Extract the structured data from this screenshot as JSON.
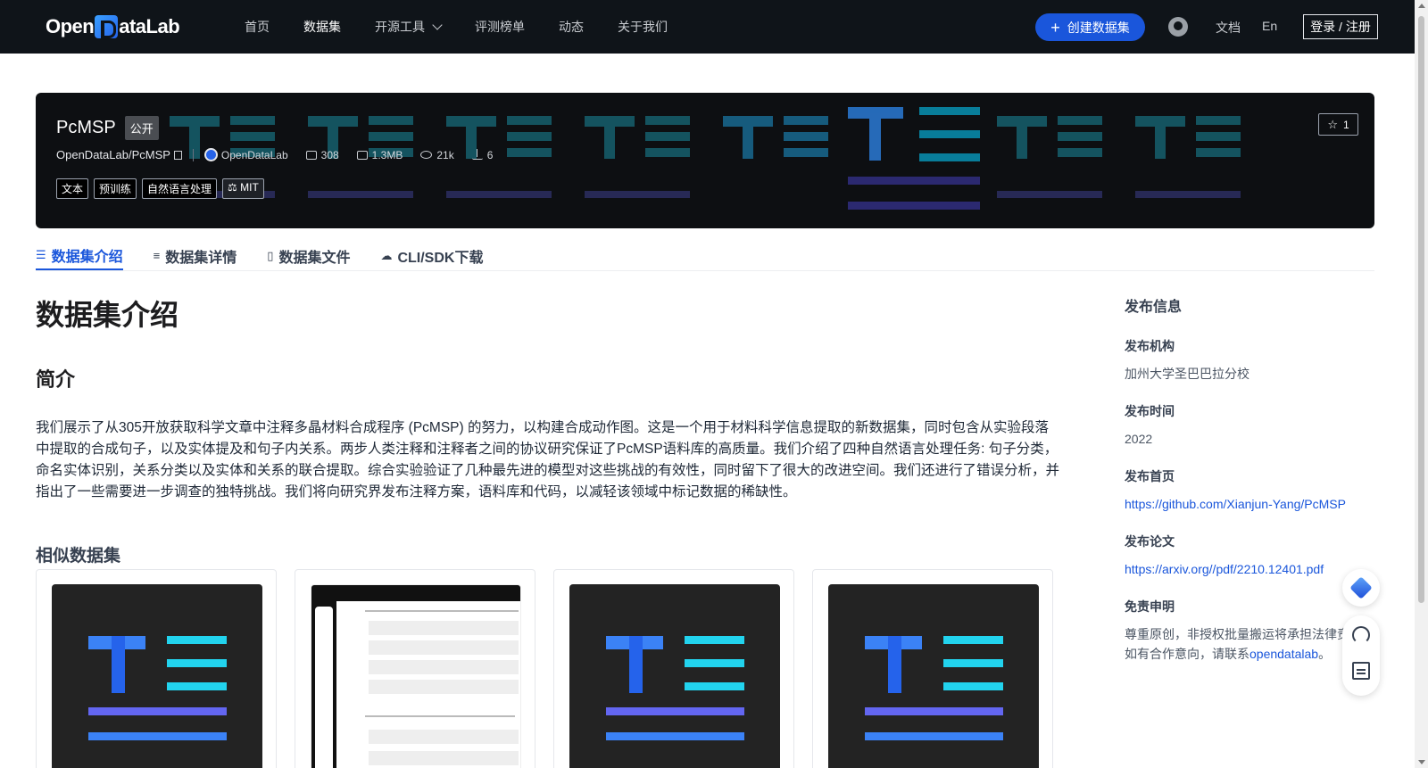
{
  "nav": {
    "logo_text": "OpenDataLab",
    "links": [
      {
        "label": "首页"
      },
      {
        "label": "数据集"
      },
      {
        "label": "开源工具"
      },
      {
        "label": "评测榜单"
      },
      {
        "label": "动态"
      },
      {
        "label": "关于我们"
      }
    ],
    "create_button": "创建数据集",
    "docs": "文档",
    "lang": "En",
    "login": "登录 / 注册"
  },
  "dataset": {
    "name": "PcMSP",
    "visibility": "公开",
    "path": "OpenDataLab/PcMSP",
    "org": "OpenDataLab",
    "files": "308",
    "size": "1.3MB",
    "views": "21k",
    "downloads": "6",
    "tags": [
      "文本",
      "预训练",
      "自然语言处理"
    ],
    "license": "MIT",
    "stars": "1"
  },
  "tabs": [
    {
      "label": "数据集介绍",
      "icon": "database-icon"
    },
    {
      "label": "数据集详情",
      "icon": "list-icon"
    },
    {
      "label": "数据集文件",
      "icon": "file-icon"
    },
    {
      "label": "CLI/SDK下载",
      "icon": "cloud-icon"
    }
  ],
  "main": {
    "heading": "数据集介绍",
    "section_title": "简介",
    "intro": "我们展示了从305开放获取科学文章中注释多晶材料合成程序 (PcMSP) 的努力，以构建合成动作图。这是一个用于材料科学信息提取的新数据集，同时包含从实验段落中提取的合成句子，以及实体提及和句子内关系。两步人类注释和注释者之间的协议研究保证了PcMSP语料库的高质量。我们介绍了四种自然语言处理任务: 句子分类，命名实体识别，关系分类以及实体和关系的联合提取。综合实验验证了几种最先进的模型对这些挑战的有效性，同时留下了很大的改进空间。我们还进行了错误分析，并指出了一些需要进一步调查的独特挑战。我们将向研究界发布注释方案，语料库和代码，以减轻该领域中标记数据的稀缺性。",
    "similar_title": "相似数据集"
  },
  "sidebar": {
    "title": "发布信息",
    "publisher_label": "发布机构",
    "publisher": "加州大学圣巴巴拉分校",
    "time_label": "发布时间",
    "time": "2022",
    "homepage_label": "发布首页",
    "homepage": "https://github.com/Xianjun-Yang/PcMSP",
    "paper_label": "发布论文",
    "paper": "https://arxiv.org//pdf/2210.12401.pdf",
    "disclaimer_label": "免责申明",
    "disclaimer_line1": "尊重原创，非授权批量搬运将承担法律责",
    "disclaimer_line2_prefix": "如有合作意向，请联系",
    "disclaimer_link": "opendatalab",
    "disclaimer_suffix": "。"
  },
  "colors": {
    "nav_bg": "#0f1419",
    "accent": "#1a56db",
    "banner_bg": "#0d0f12"
  }
}
